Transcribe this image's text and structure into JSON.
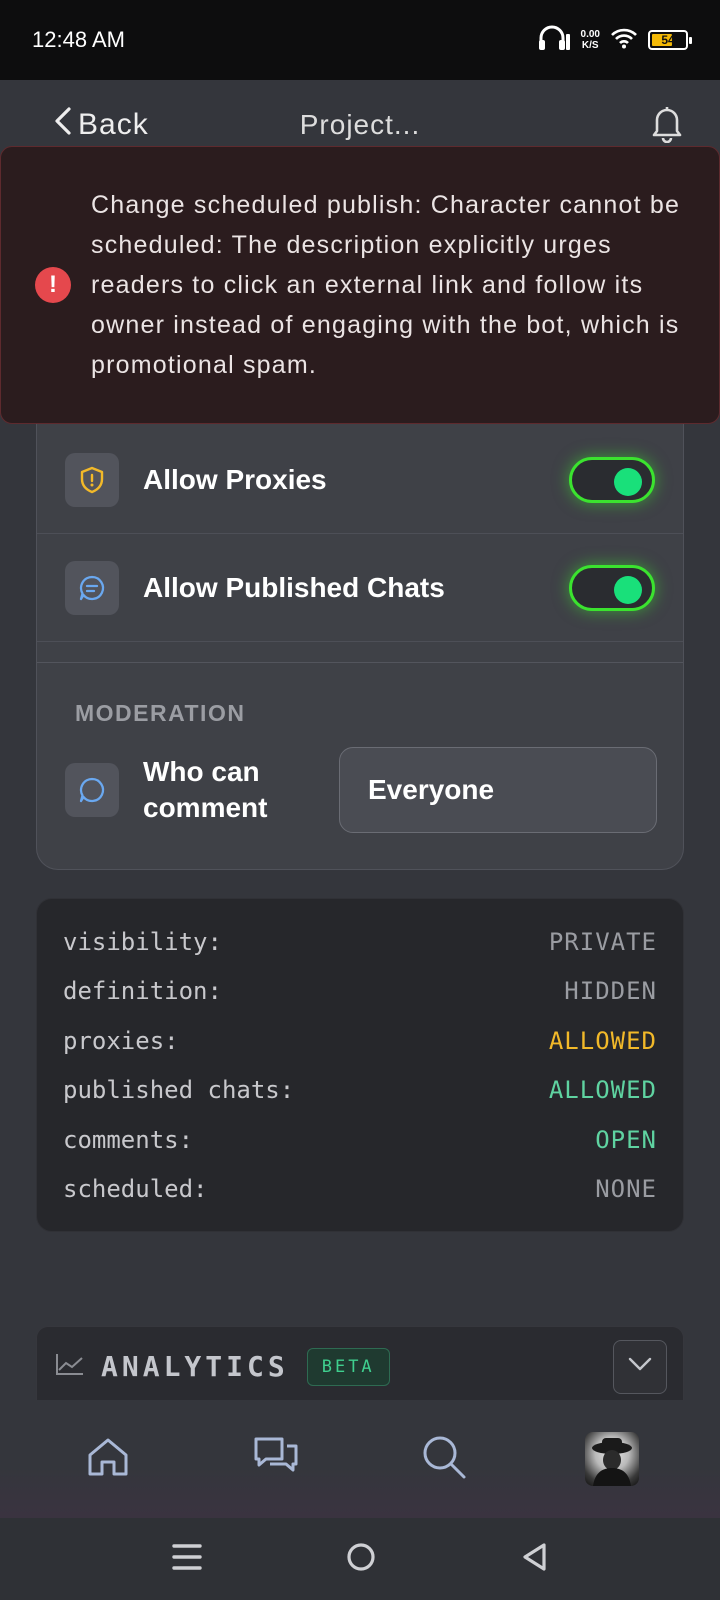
{
  "status_bar": {
    "time": "12:48 AM",
    "net_speed_value": "0.00",
    "net_speed_unit": "K/S",
    "battery_level": "54"
  },
  "header": {
    "back_label": "Back",
    "title": "Project..."
  },
  "toast": {
    "message": "Change scheduled publish: Character cannot be scheduled: The description explicitly urges readers to click an external link and follow its owner instead of engaging with the bot, which is promotional spam.",
    "icon": "alert-circle-icon",
    "color": "#e5484d"
  },
  "settings": {
    "toggles": [
      {
        "label": "Allow Proxies",
        "icon": "shield-alert-icon",
        "on": true
      },
      {
        "label": "Allow Published Chats",
        "icon": "chat-bubble-icon",
        "on": true
      }
    ],
    "moderation_title": "MODERATION",
    "who_can_comment": {
      "label": "Who can comment",
      "value": "Everyone"
    }
  },
  "summary": [
    {
      "key": "visibility:",
      "value": "PRIVATE",
      "color": "#9a9ca2"
    },
    {
      "key": "definition:",
      "value": "HIDDEN",
      "color": "#9a9ca2"
    },
    {
      "key": "proxies:",
      "value": "ALLOWED",
      "color": "#f2b929"
    },
    {
      "key": "published chats:",
      "value": "ALLOWED",
      "color": "#5fd3a1"
    },
    {
      "key": "comments:",
      "value": "OPEN",
      "color": "#5fd3a1"
    },
    {
      "key": "scheduled:",
      "value": "NONE",
      "color": "#9a9ca2"
    }
  ],
  "analytics": {
    "label": "ANALYTICS",
    "badge": "BETA"
  },
  "bottom_nav": [
    "home-icon",
    "chats-icon",
    "search-icon",
    "profile-avatar"
  ],
  "colors": {
    "accent_green": "#3be32f",
    "toggle_knob": "#19e07a",
    "background": "#34363c"
  }
}
